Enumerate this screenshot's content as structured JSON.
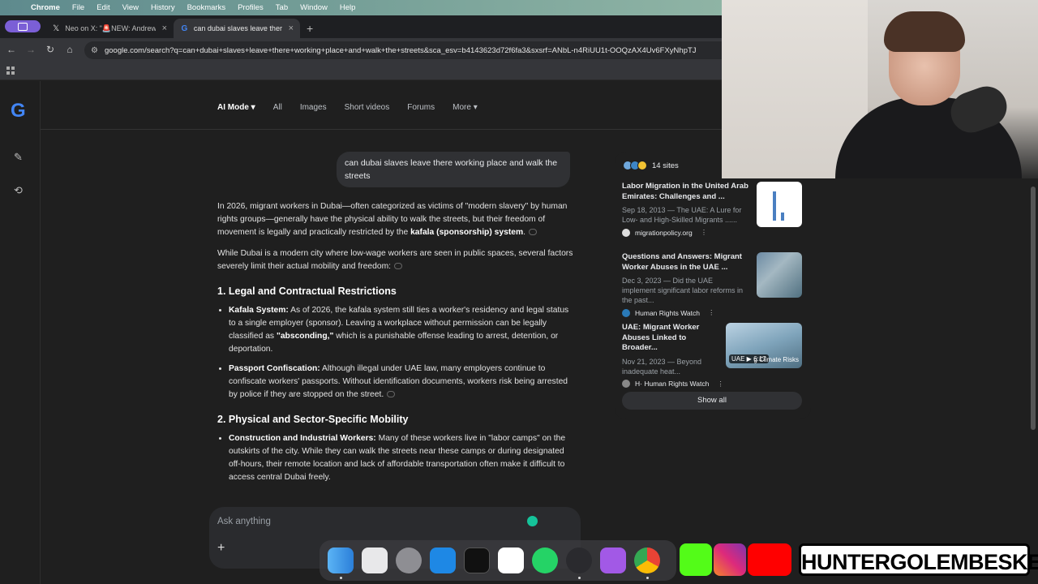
{
  "menubar": {
    "app": "Chrome",
    "items": [
      "File",
      "Edit",
      "View",
      "History",
      "Bookmarks",
      "Profiles",
      "Tab",
      "Window",
      "Help"
    ]
  },
  "tabs": [
    {
      "label": "Neo on X: \"🚨NEW: Andrew T",
      "icon": "x-logo-icon"
    },
    {
      "label": "can dubai slaves leave there",
      "icon": "google-g-icon",
      "active": true
    }
  ],
  "address": {
    "url": "google.com/search?q=can+dubai+slaves+leave+there+working+place+and+walk+the+streets&sca_esv=b4143623d72f6fa3&sxsrf=ANbL-n4RiUU1t-OOQzAX4Uv6FXyNhpTJ"
  },
  "search_tabs": [
    "AI Mode",
    "All",
    "Images",
    "Short videos",
    "Forums",
    "More"
  ],
  "query": "can dubai slaves leave there working place and walk the streets",
  "answer": {
    "p1_a": "In 2026, migrant workers in Dubai—often categorized as victims of \"modern slavery\" by human rights groups—generally have the physical ability to walk the streets, but their freedom of movement is legally and practically restricted by the ",
    "p1_b": "kafala (sponsorship) system",
    "p1_c": ".",
    "p2": "While Dubai is a modern city where low-wage workers are seen in public spaces, several factors severely limit their actual mobility and freedom:",
    "h1": "1. Legal and Contractual Restrictions",
    "b1_label": "Kafala System:",
    "b1_a": " As of 2026, the kafala system still ties a worker's residency and legal status to a single employer (sponsor). Leaving a workplace without permission can be legally classified as ",
    "b1_b": "\"absconding,\"",
    "b1_c": " which is a punishable offense leading to arrest, detention, or deportation.",
    "b2_label": "Passport Confiscation:",
    "b2_text": " Although illegal under UAE law, many employers continue to confiscate workers' passports. Without identification documents, workers risk being arrested by police if they are stopped on the street.",
    "h2": "2. Physical and Sector-Specific Mobility",
    "b3_label": "Construction and Industrial Workers:",
    "b3_text": " Many of these workers live in \"labor camps\" on the outskirts of the city. While they can walk the streets near these camps or during designated off-hours, their remote location and lack of affordable transportation often make it difficult to access central Dubai freely."
  },
  "ask": {
    "placeholder": "Ask anything"
  },
  "sources": {
    "count_label": "14 sites",
    "items": [
      {
        "title": "Labor Migration in the United Arab Emirates: Challenges and ...",
        "snippet": "Sep 18, 2013 — The UAE: A Lure for Low- and High-Skilled Migrants ......",
        "site": "migrationpolicy.org"
      },
      {
        "title": "Questions and Answers: Migrant Worker Abuses in the UAE ...",
        "snippet": "Dec 3, 2023 — Did the UAE implement significant labor reforms in the past...",
        "site": "Human Rights Watch"
      },
      {
        "title": "UAE: Migrant Worker Abuses Linked to Broader...",
        "snippet": "Nov 21, 2023 — Beyond inadequate heat...",
        "site": "H· Human Rights Watch",
        "video_duration": "6:17",
        "video_caption": "g Climate Risks",
        "video_tag": "UAE"
      }
    ],
    "show_all": "Show all"
  },
  "overlay": {
    "brand": "HUNTERGOLEMBESKE"
  },
  "colors": {
    "accent_purple": "#7b5fd6",
    "gemini_green": "#15c39a",
    "bg": "#1f1f1f"
  }
}
